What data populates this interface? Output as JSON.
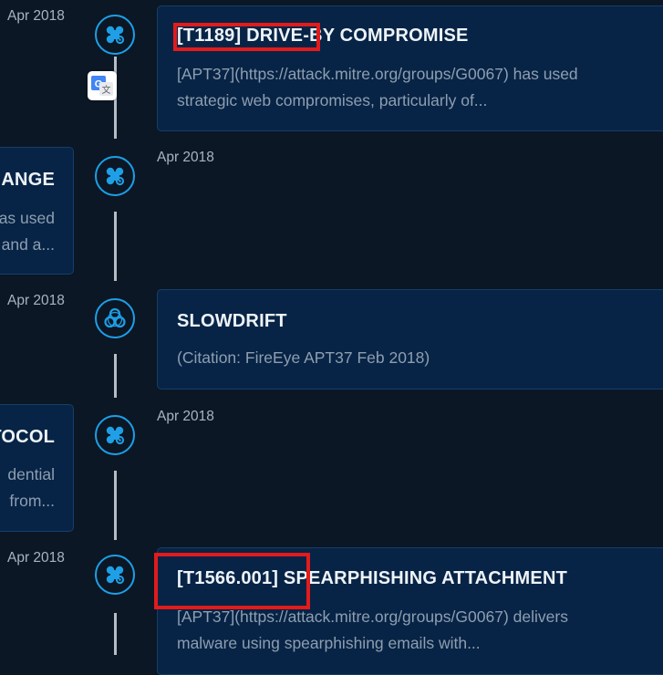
{
  "timeline": {
    "entries": [
      {
        "date": "Apr 2018",
        "icon": "technique-icon",
        "title": "[T1189] DRIVE-BY COMPROMISE",
        "desc_lines": [
          "[APT37](https://attack.mitre.org/groups/G0067) has used",
          "strategic web compromises, particularly of..."
        ]
      },
      {
        "date": "Apr 2018",
        "icon": "technique-icon",
        "title": "HANGE",
        "desc_lines": [
          "as used",
          "and a..."
        ]
      },
      {
        "date": "Apr 2018",
        "icon": "biohazard-icon",
        "title": "SLOWDRIFT",
        "desc_lines": [
          "(Citation: FireEye APT37 Feb 2018)"
        ]
      },
      {
        "date": "Apr 2018",
        "icon": "technique-icon",
        "title": "TOCOL",
        "desc_lines": [
          "dential",
          "from..."
        ]
      },
      {
        "date": "Apr 2018",
        "icon": "technique-icon",
        "title": "[T1566.001] SPEARPHISHING ATTACHMENT",
        "desc_lines": [
          "[APT37](https://attack.mitre.org/groups/G0067) delivers",
          "malware using spearphishing emails with..."
        ]
      }
    ]
  },
  "translate_badge": {
    "icon": "google-translate-icon",
    "letter": "G"
  },
  "colors": {
    "background": "#0b1725",
    "card": "#072446",
    "accent": "#1e9fe6",
    "highlight": "#e21b1b"
  }
}
